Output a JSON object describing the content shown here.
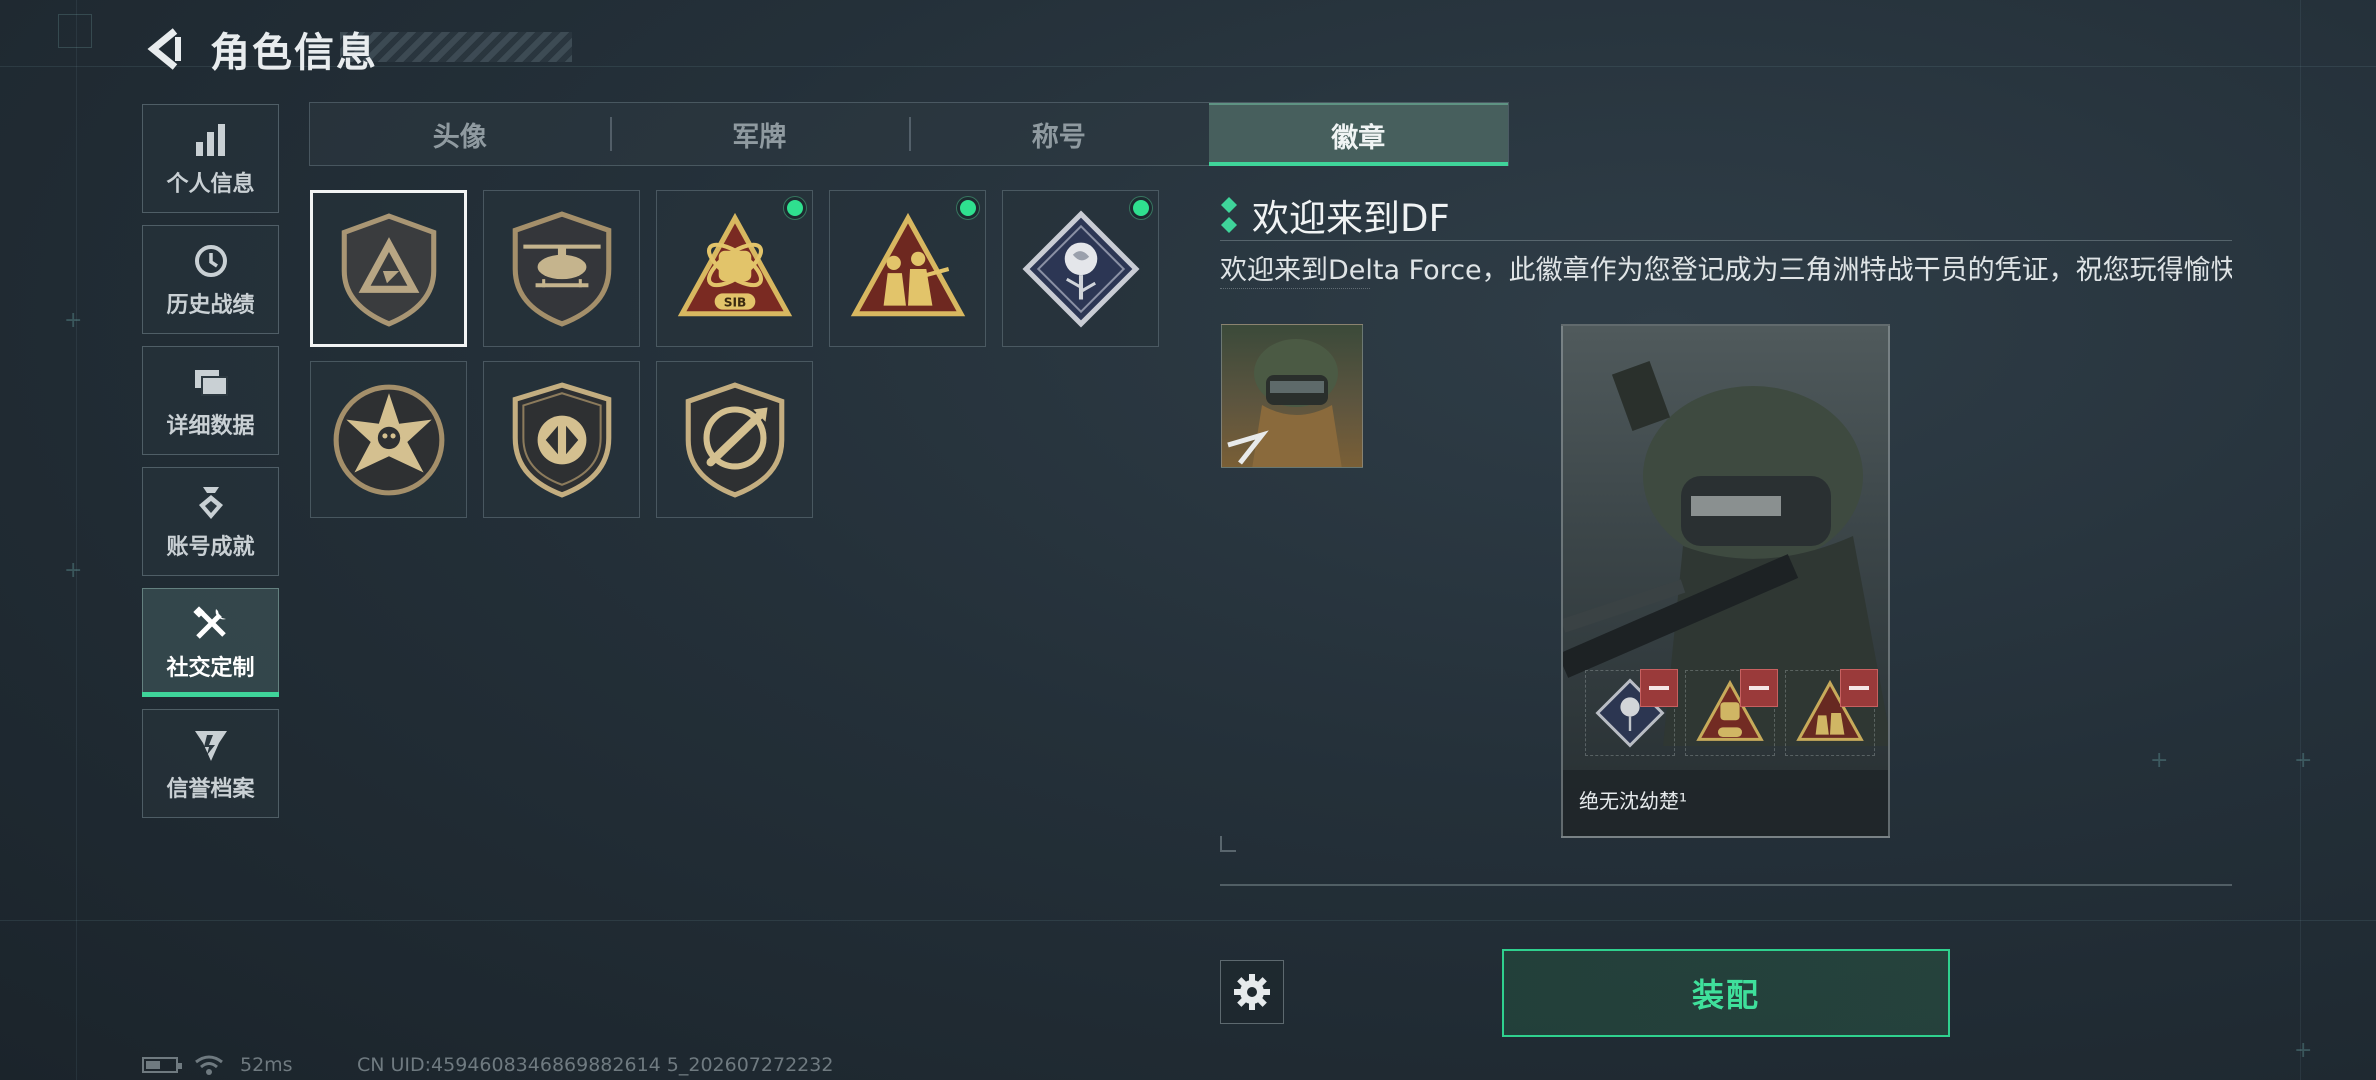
{
  "header": {
    "title": "角色信息",
    "back_icon": "back-arrow-icon"
  },
  "sidebar": {
    "items": [
      {
        "label": "个人信息",
        "icon": "bar-chart-icon",
        "active": false
      },
      {
        "label": "历史战绩",
        "icon": "history-clock-icon",
        "active": false
      },
      {
        "label": "详细数据",
        "icon": "folders-icon",
        "active": false
      },
      {
        "label": "账号成就",
        "icon": "achievement-icon",
        "active": false
      },
      {
        "label": "社交定制",
        "icon": "tools-icon",
        "active": true
      },
      {
        "label": "信誉档案",
        "icon": "reputation-icon",
        "active": false
      }
    ]
  },
  "tabs": [
    {
      "label": "头像",
      "active": false
    },
    {
      "label": "军牌",
      "active": false
    },
    {
      "label": "称号",
      "active": false
    },
    {
      "label": "徽章",
      "active": true
    }
  ],
  "badges": [
    {
      "name": "delta-shield-badge",
      "selected": true,
      "equipped": false
    },
    {
      "name": "helicopter-badge",
      "selected": false,
      "equipped": false
    },
    {
      "name": "sib-atom-fist-badge",
      "selected": false,
      "equipped": true
    },
    {
      "name": "soldiers-triangle-badge",
      "selected": false,
      "equipped": true
    },
    {
      "name": "rose-diamond-badge",
      "selected": false,
      "equipped": true
    },
    {
      "name": "star-skull-badge",
      "selected": false,
      "equipped": false
    },
    {
      "name": "arrow-shield-badge",
      "selected": false,
      "equipped": false
    },
    {
      "name": "knife-shield-badge",
      "selected": false,
      "equipped": false
    }
  ],
  "detail": {
    "title": "欢迎来到DF",
    "description": "欢迎来到Delta Force，此徽章作为您登记成为三角洲特战干员的凭证，祝您玩得愉快"
  },
  "preview": {
    "player_name": "绝无沈幼楚¹",
    "equipped": [
      "rose-diamond-badge",
      "sib-atom-fist-badge",
      "soldiers-triangle-badge"
    ]
  },
  "actions": {
    "equip_label": "装配",
    "settings_icon": "gear-icon"
  },
  "status": {
    "ping": "52ms",
    "uid": "CN UID:4594608346869882614 5_202607272232"
  },
  "colors": {
    "accent": "#3fd49a",
    "equipped_dot": "#2fe08f",
    "remove": "#9a3a3a"
  }
}
